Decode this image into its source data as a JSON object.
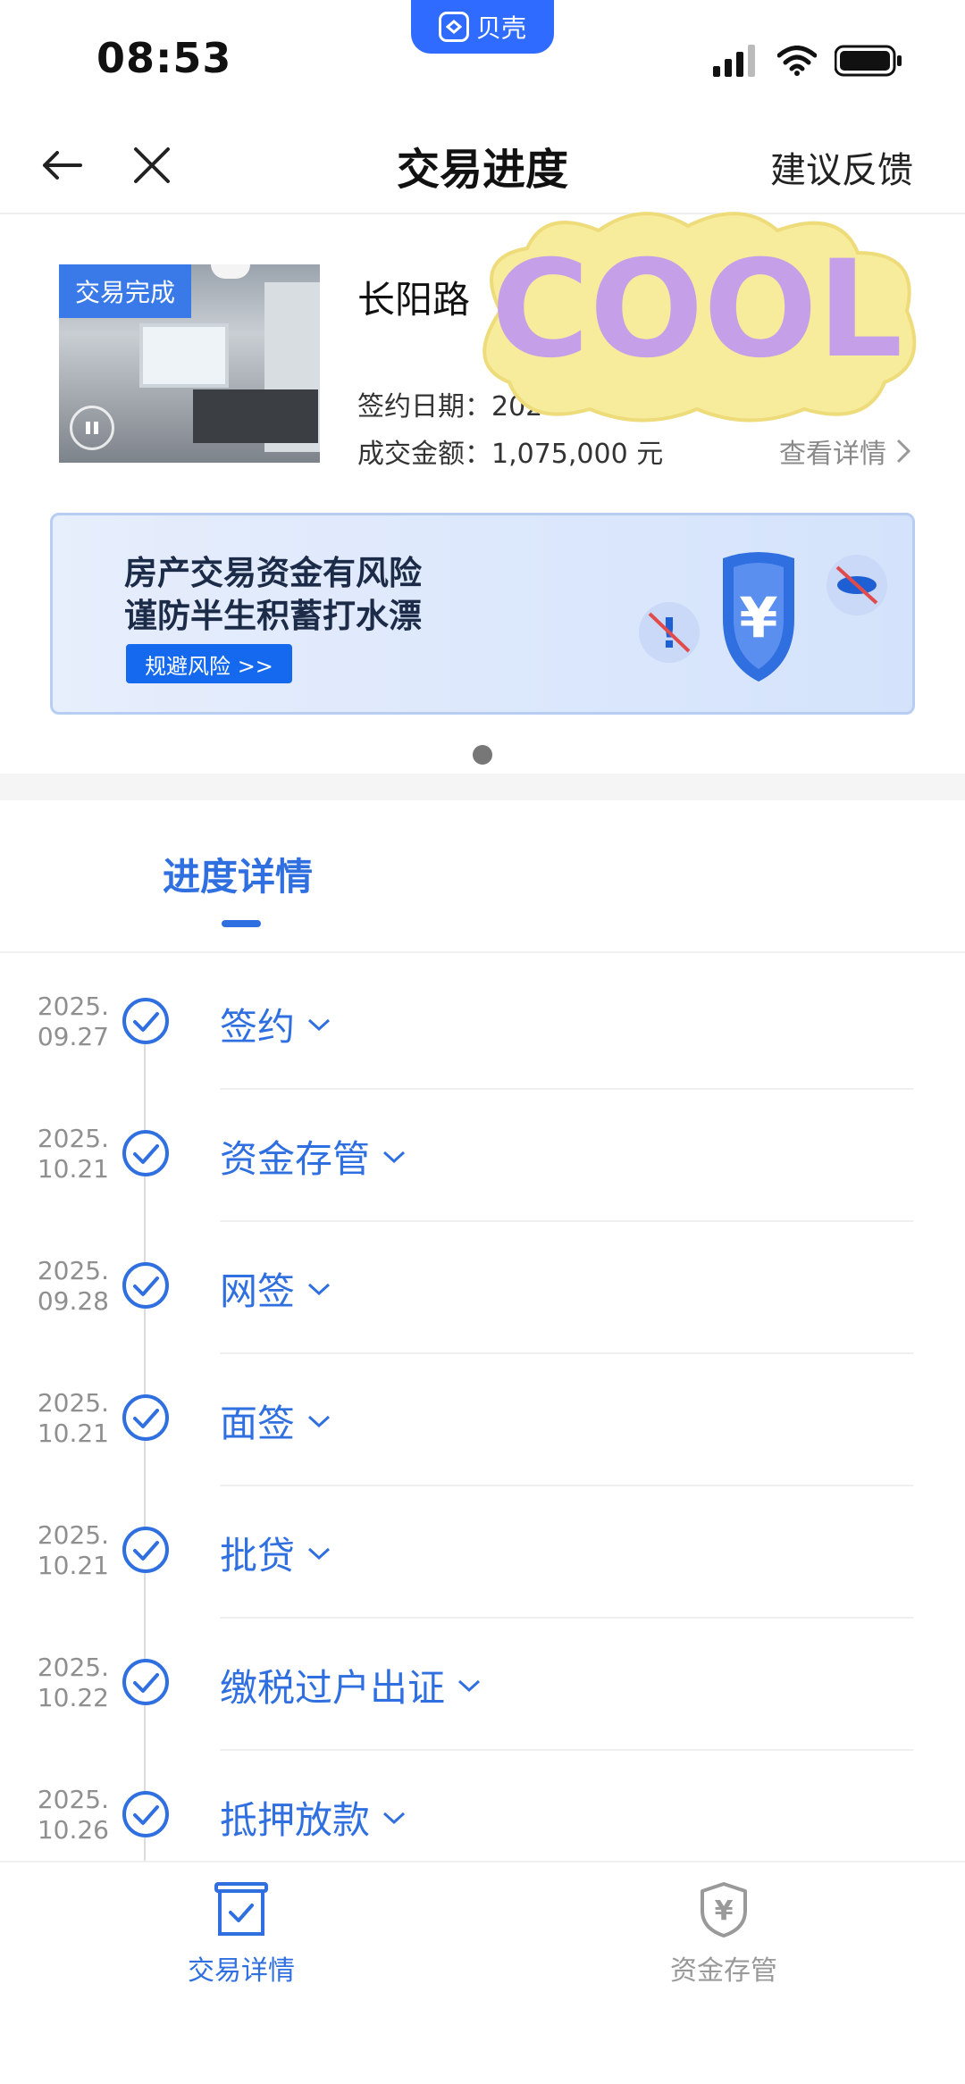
{
  "status_bar": {
    "time": "08:53",
    "app_pill": "贝壳"
  },
  "nav": {
    "title": "交易进度",
    "feedback": "建议反馈"
  },
  "property": {
    "badge": "交易完成",
    "name": "长阳路",
    "sign_date_label": "签约日期：",
    "sign_date_value": "202",
    "amount_label": "成交金额：",
    "amount_value": "1,075,000 元",
    "detail_link": "查看详情"
  },
  "sticker": {
    "text": "COOL"
  },
  "banner": {
    "line1": "房产交易资金有风险",
    "line2": "谨防半生积蓄打水漂",
    "button": "规避风险 >>"
  },
  "tab": {
    "label": "进度详情"
  },
  "steps": [
    {
      "date1": "2025.",
      "date2": "09.27",
      "label": "签约"
    },
    {
      "date1": "2025.",
      "date2": "10.21",
      "label": "资金存管"
    },
    {
      "date1": "2025.",
      "date2": "09.28",
      "label": "网签"
    },
    {
      "date1": "2025.",
      "date2": "10.21",
      "label": "面签"
    },
    {
      "date1": "2025.",
      "date2": "10.21",
      "label": "批贷"
    },
    {
      "date1": "2025.",
      "date2": "10.22",
      "label": "缴税过户出证"
    },
    {
      "date1": "2025.",
      "date2": "10.26",
      "label": "抵押放款"
    }
  ],
  "bottom_tabs": [
    {
      "label": "交易详情",
      "icon": "box-check-icon",
      "active": true
    },
    {
      "label": "资金存管",
      "icon": "shield-yen-icon",
      "active": false
    }
  ],
  "colors": {
    "accent": "#2f6fe0",
    "brand": "#2f6bff"
  }
}
